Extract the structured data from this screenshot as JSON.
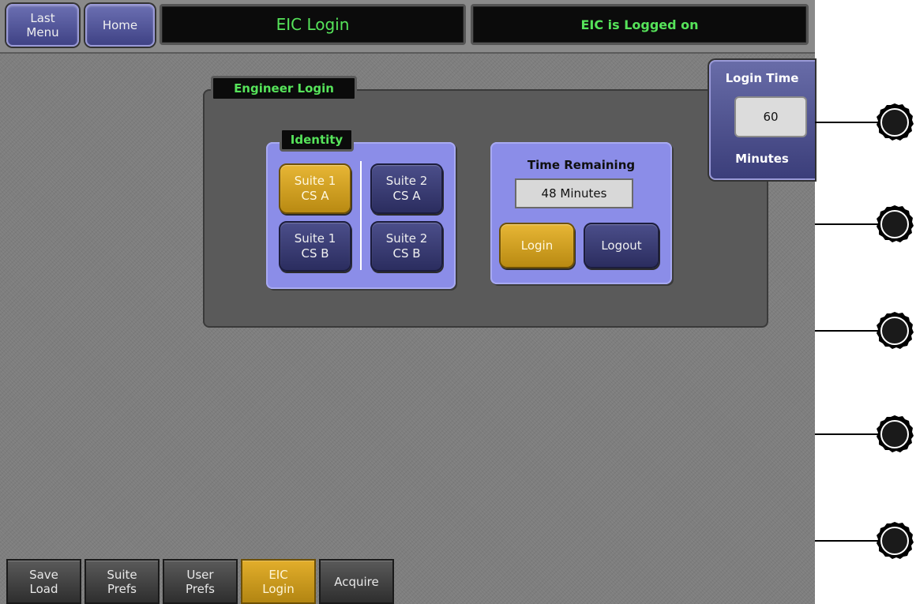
{
  "topbar": {
    "last_menu": "Last\nMenu",
    "home": "Home",
    "title": "EIC Login",
    "status": "EIC is Logged on"
  },
  "panel": {
    "title": "Engineer Login",
    "identity": {
      "title": "Identity",
      "buttons": [
        {
          "label": "Suite 1\nCS A",
          "selected": true
        },
        {
          "label": "Suite 2\nCS A",
          "selected": false
        },
        {
          "label": "Suite 1\nCS B",
          "selected": false
        },
        {
          "label": "Suite 2\nCS B",
          "selected": false
        }
      ]
    },
    "time": {
      "title": "Time Remaining",
      "value": "48 Minutes",
      "login": "Login",
      "logout": "Logout"
    }
  },
  "softknob": {
    "title": "Login Time",
    "value": "60",
    "units": "Minutes"
  },
  "bottom_tabs": [
    {
      "label": "Save\nLoad",
      "active": false
    },
    {
      "label": "Suite\nPrefs",
      "active": false
    },
    {
      "label": "User\nPrefs",
      "active": false
    },
    {
      "label": "EIC\nLogin",
      "active": true
    },
    {
      "label": "Acquire",
      "active": false
    }
  ],
  "colors": {
    "accent_gold": "#e2ae2b",
    "button_blue": "#3f4285",
    "group_violet": "#8b8de8",
    "title_green": "#56e35a"
  },
  "knobs": [
    "knob-icon",
    "knob-icon",
    "knob-icon",
    "knob-icon",
    "knob-icon"
  ]
}
